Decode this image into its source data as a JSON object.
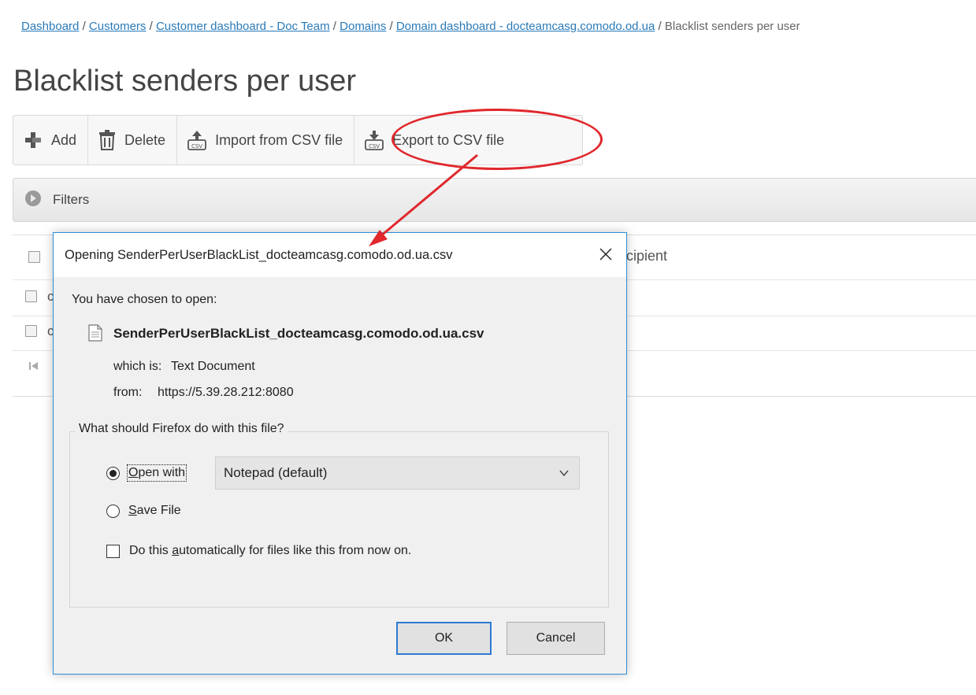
{
  "breadcrumb": {
    "items": [
      "Dashboard",
      "Customers",
      "Customer dashboard - Doc Team",
      "Domains",
      "Domain dashboard - docteamcasg.comodo.od.ua"
    ],
    "separator": "/",
    "current": "Blacklist senders per user"
  },
  "page": {
    "title": "Blacklist senders per user"
  },
  "toolbar": {
    "add_label": "Add",
    "delete_label": "Delete",
    "import_label": "Import from CSV file",
    "export_label": "Export to CSV file"
  },
  "filters": {
    "label": "Filters"
  },
  "grid": {
    "visible_header_fragment": "cipient",
    "row_stub_text": "c"
  },
  "dialog": {
    "title": "Opening SenderPerUserBlackList_docteamcasg.comodo.od.ua.csv",
    "chosen_text": "You have chosen to open:",
    "file_name": "SenderPerUserBlackList_docteamcasg.comodo.od.ua.csv",
    "which_is_label": "which is:",
    "which_is_value": "Text Document",
    "from_label": "from:",
    "from_value": "https://5.39.28.212:8080",
    "question": "What should Firefox do with this file?",
    "open_with_prefix": "",
    "open_with_ul": "O",
    "open_with_rest": "pen with",
    "open_with_app": "Notepad (default)",
    "save_file_ul": "S",
    "save_file_rest": "ave File",
    "auto_prefix": "Do this ",
    "auto_ul": "a",
    "auto_rest": "utomatically for files like this from now on.",
    "ok_label": "OK",
    "cancel_label": "Cancel"
  },
  "colors": {
    "link": "#2a7ab8",
    "annotation": "#e0282d",
    "dialog_border": "#2e8fd8"
  }
}
